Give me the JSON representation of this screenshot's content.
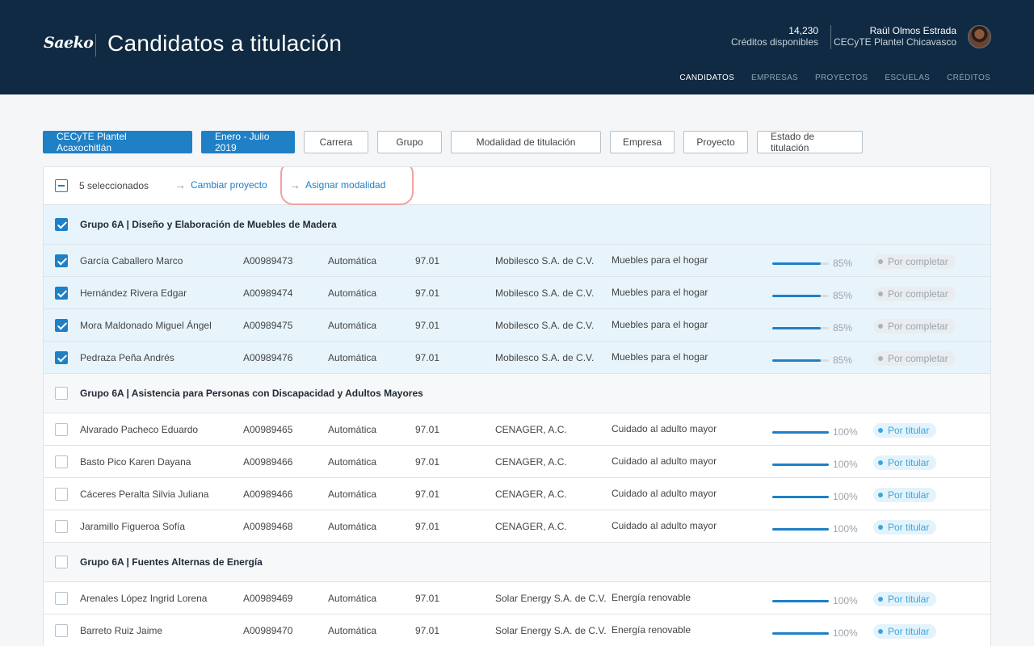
{
  "header": {
    "logo": "Saeko",
    "title": "Candidatos a titulación",
    "credits_value": "14,230",
    "credits_label": "Créditos disponibles",
    "user_name": "Raúl Olmos Estrada",
    "user_org": "CECyTE Plantel Chicavasco",
    "nav": [
      "CANDIDATOS",
      "EMPRESAS",
      "PROYECTOS",
      "ESCUELAS",
      "CRÉDITOS"
    ]
  },
  "filters": [
    "CECyTE Plantel Acaxochitlán",
    "Enero - Julio 2019",
    "Carrera",
    "Grupo",
    "Modalidad de titulación",
    "Empresa",
    "Proyecto",
    "Estado de titulación"
  ],
  "toolbar": {
    "count": "5 seleccionados",
    "action1": "Cambiar proyecto",
    "action2": "Asignar modalidad"
  },
  "groups": [
    {
      "title": "Grupo 6A | Diseño y Elaboración de Muebles de Madera",
      "rows": [
        {
          "name": "García Caballero Marco",
          "id": "A00989473",
          "mode": "Automática",
          "score": "97.01",
          "company": "Mobilesco S.A. de C.V.",
          "project": "Muebles para el hogar",
          "progress": "85%",
          "status": "Por completar"
        },
        {
          "name": "Hernández Rivera Edgar",
          "id": "A00989474",
          "mode": "Automática",
          "score": "97.01",
          "company": "Mobilesco S.A. de C.V.",
          "project": "Muebles para el hogar",
          "progress": "85%",
          "status": "Por completar"
        },
        {
          "name": "Mora Maldonado Miguel Ángel",
          "id": "A00989475",
          "mode": "Automática",
          "score": "97.01",
          "company": "Mobilesco S.A. de C.V.",
          "project": "Muebles para el hogar",
          "progress": "85%",
          "status": "Por completar"
        },
        {
          "name": "Pedraza Peña Andrés",
          "id": "A00989476",
          "mode": "Automática",
          "score": "97.01",
          "company": "Mobilesco S.A. de C.V.",
          "project": "Muebles para el hogar",
          "progress": "85%",
          "status": "Por completar"
        }
      ]
    },
    {
      "title": "Grupo 6A | Asistencia para Personas con Discapacidad y Adultos Mayores",
      "rows": [
        {
          "name": "Alvarado Pacheco Eduardo",
          "id": "A00989465",
          "mode": "Automática",
          "score": "97.01",
          "company": "CENAGER, A.C.",
          "project": "Cuidado al adulto mayor",
          "progress": "100%",
          "status": "Por titular"
        },
        {
          "name": "Basto Pico Karen Dayana",
          "id": "A00989466",
          "mode": "Automática",
          "score": "97.01",
          "company": "CENAGER, A.C.",
          "project": "Cuidado al adulto mayor",
          "progress": "100%",
          "status": "Por titular"
        },
        {
          "name": "Cáceres Peralta Silvia Juliana",
          "id": "A00989466",
          "mode": "Automática",
          "score": "97.01",
          "company": "CENAGER, A.C.",
          "project": "Cuidado al adulto mayor",
          "progress": "100%",
          "status": "Por titular"
        },
        {
          "name": "Jaramillo Figueroa Sofía",
          "id": "A00989468",
          "mode": "Automática",
          "score": "97.01",
          "company": "CENAGER, A.C.",
          "project": "Cuidado al adulto mayor",
          "progress": "100%",
          "status": "Por titular"
        }
      ]
    },
    {
      "title": "Grupo 6A | Fuentes Alternas de Energía",
      "rows": [
        {
          "name": "Arenales López Ingrid Lorena",
          "id": "A00989469",
          "mode": "Automática",
          "score": "97.01",
          "company": "Solar Energy S.A. de C.V.",
          "project": "Energía renovable",
          "progress": "100%",
          "status": "Por titular"
        },
        {
          "name": "Barreto Ruiz Jaime",
          "id": "A00989470",
          "mode": "Automática",
          "score": "97.01",
          "company": "Solar Energy S.A. de C.V.",
          "project": "Energía renovable",
          "progress": "100%",
          "status": "Por titular"
        }
      ]
    }
  ],
  "colors": {
    "header_bg": "#0f2a42",
    "accent": "#1f80c6",
    "selected_row": "#e8f4fb",
    "highlight": "#f0a39b"
  }
}
